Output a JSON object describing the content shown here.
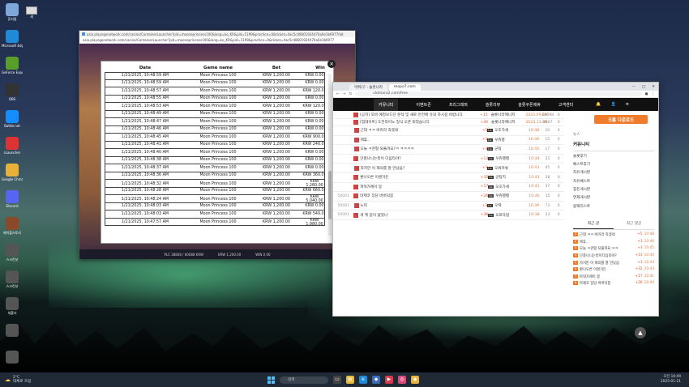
{
  "desktop": {
    "icons": [
      {
        "label": "휴지통",
        "icon": "recycle-bin-icon",
        "color": "#7fa7d9"
      },
      {
        "label": "Microsoft Edge",
        "icon": "edge-icon",
        "color": "#1f8ad8"
      },
      {
        "label": "GeForce Experience",
        "icon": "geforce-icon",
        "color": "#5a9e2a"
      },
      {
        "label": "OBS",
        "icon": "obs-icon",
        "color": "#333"
      },
      {
        "label": "Battle.net",
        "icon": "battlenet-icon",
        "color": "#148eff"
      },
      {
        "label": "sLauncher",
        "icon": "slauncher-icon",
        "color": "#d33"
      },
      {
        "label": "Google Chrome",
        "icon": "chrome-icon",
        "color": "#e8b23a"
      },
      {
        "label": "Discord",
        "icon": "discord-icon",
        "color": "#5865f2"
      },
      {
        "label": "메이플스토리",
        "icon": "game-icon",
        "color": "#8a4a2a"
      },
      {
        "label": "스크린샷",
        "icon": "folder-icon",
        "color": "#555"
      },
      {
        "label": "스크린샷",
        "icon": "folder-icon",
        "color": "#555"
      },
      {
        "label": "새폴더",
        "icon": "folder-icon",
        "color": "#555"
      },
      {
        "label": "",
        "icon": "file-icon",
        "color": "#555"
      },
      {
        "label": "",
        "icon": "file-icon",
        "color": "#555"
      }
    ],
    "second_icon_label": "새"
  },
  "popup": {
    "title": "asia.playngonetwork.com/casino/ContainerLauncher?pid=mooneprincess100&lang=ko_KR&pid=1199&practice=0&ticket=4ac5c48601924470a0e1b6977fa8",
    "url": "asia.playngonetwork.com/casino/ContainerLauncher?pid=mooneprincess100&lang=ko_KR&pid=1199&practice=0&ticket=4ac5c48601924470a0e1b6977",
    "game_footer": [
      "PLC 38808 / 60088 KRW",
      "KRW 1,200.00",
      "WIN 0.00"
    ],
    "history": {
      "headers": {
        "date": "Date",
        "game": "Game name",
        "bet": "Bet",
        "win": "Win"
      },
      "rows": [
        {
          "date": "1/21/2025, 10:48:59 AM",
          "game": "Moon Princess 100",
          "bet": "KRW 1,200.00",
          "win": "KRW 0.00"
        },
        {
          "date": "1/21/2025, 10:48:59 AM",
          "game": "Moon Princess 100",
          "bet": "KRW 1,200.00",
          "win": "KRW 0.00"
        },
        {
          "date": "1/21/2025, 10:48:57 AM",
          "game": "Moon Princess 100",
          "bet": "KRW 1,200.00",
          "win": "KRW 120.00"
        },
        {
          "date": "1/21/2025, 10:48:55 AM",
          "game": "Moon Princess 100",
          "bet": "KRW 1,200.00",
          "win": "KRW 0.00"
        },
        {
          "date": "1/21/2025, 10:48:53 AM",
          "game": "Moon Princess 100",
          "bet": "KRW 1,200.00",
          "win": "KRW 120.00"
        },
        {
          "date": "1/21/2025, 10:48:49 AM",
          "game": "Moon Princess 100",
          "bet": "KRW 1,200.00",
          "win": "KRW 0.00"
        },
        {
          "date": "1/21/2025, 10:48:47 AM",
          "game": "Moon Princess 100",
          "bet": "KRW 1,200.00",
          "win": "KRW 0.00"
        },
        {
          "date": "1/21/2025, 10:48:46 AM",
          "game": "Moon Princess 100",
          "bet": "KRW 1,200.00",
          "win": "KRW 0.00"
        },
        {
          "date": "1/21/2025, 10:48:45 AM",
          "game": "Moon Princess 100",
          "bet": "KRW 1,200.00",
          "win": "KRW 900.00"
        },
        {
          "date": "1/21/2025, 10:48:41 AM",
          "game": "Moon Princess 100",
          "bet": "KRW 1,200.00",
          "win": "KRW 240.00"
        },
        {
          "date": "1/21/2025, 10:48:40 AM",
          "game": "Moon Princess 100",
          "bet": "KRW 1,200.00",
          "win": "KRW 0.00"
        },
        {
          "date": "1/21/2025, 10:48:38 AM",
          "game": "Moon Princess 100",
          "bet": "KRW 1,200.00",
          "win": "KRW 0.00"
        },
        {
          "date": "1/21/2025, 10:48:37 AM",
          "game": "Moon Princess 100",
          "bet": "KRW 1,200.00",
          "win": "KRW 0.00"
        },
        {
          "date": "1/21/2025, 10:48:36 AM",
          "game": "Moon Princess 100",
          "bet": "KRW 1,200.00",
          "win": "KRW 360.00"
        },
        {
          "date": "1/21/2025, 10:48:32 AM",
          "game": "Moon Princess 100",
          "bet": "KRW 1,200.00",
          "win": "KRW 1,260.00"
        },
        {
          "date": "1/21/2025, 10:48:28 AM",
          "game": "Moon Princess 100",
          "bet": "KRW 1,200.00",
          "win": "KRW 660.00"
        },
        {
          "date": "1/21/2025, 10:48:24 AM",
          "game": "Moon Princess 100",
          "bet": "KRW 1,200.00",
          "win": "KRW 5,040.00"
        },
        {
          "date": "1/21/2025, 10:48:03 AM",
          "game": "Moon Princess 100",
          "bet": "KRW 1,200.00",
          "win": "KRW 0.00"
        },
        {
          "date": "1/21/2025, 10:48:03 AM",
          "game": "Moon Princess 100",
          "bet": "KRW 1,200.00",
          "win": "KRW 540.00"
        },
        {
          "date": "1/21/2025, 10:47:57 AM",
          "game": "Moon Princess 100",
          "bet": "KRW 1,200.00",
          "win": "KRW 1,980.00"
        }
      ]
    }
  },
  "browser": {
    "tabs": [
      "먹튀/구 - 슬롯나라",
      "mopo7.com"
    ],
    "url": "slotnara2.com/free",
    "nav": [
      "커뮤니티",
      "이벤트존",
      "프리그래퍼",
      "슬롯리뷰",
      "슬롯쿠폰제휴",
      "고객센터"
    ],
    "nav_active": "커뮤니티",
    "posts": [
      {
        "no": "",
        "title": "[공지] 모바 예정보드단 분석 및 새로 안전에 유의 하시길 바랍니다.",
        "count": "+15",
        "author": "슬롯나라매니저",
        "lv": "",
        "date": "2023.09.08",
        "views": "22698",
        "likes": "0"
      },
      {
        "no": "",
        "title": "[업데이트] 도전라이노 정식 오픈 되었습니다",
        "count": "+39",
        "author": "슬롯나라매니저",
        "lv": "",
        "date": "2024.11.05",
        "views": "8907",
        "likes": "0"
      },
      {
        "no": "",
        "title": "근데 ㅋㅋ 바카라 죽겠네",
        "count": "+5",
        "author": "오호가세",
        "lv": "Lv.",
        "date": "10:48",
        "views": "10",
        "likes": "0"
      },
      {
        "no": "",
        "title": "에휴..",
        "count": "+3",
        "author": "우쥬쭝",
        "lv": "Lv.",
        "date": "10:46",
        "views": "15",
        "likes": "0"
      },
      {
        "no": "",
        "title": "오늘 ㅋ관형 되줄까요?ㅋ ㅋㅋㅋㅋ",
        "count": "+3",
        "author": "군팅",
        "lv": "Lv.",
        "date": "10:45",
        "views": "17",
        "likes": "0"
      },
      {
        "no": "",
        "title": "단풍나니는킹이 다음타야?",
        "count": "+13",
        "author": "우쥬팽팽",
        "lv": "Lv.",
        "date": "10:44",
        "views": "21",
        "likes": "0"
      },
      {
        "no": "",
        "title": "자지만 이 재의를 잘 만났음?",
        "count": "+3",
        "author": "오류카류",
        "lv": "Lv.",
        "date": "10:43",
        "views": "45",
        "likes": "0"
      },
      {
        "no": "",
        "title": "환나오른 이렌거든",
        "count": "+32",
        "author": "군팅지",
        "lv": "Lv.",
        "date": "10:43",
        "views": "28",
        "likes": "0"
      },
      {
        "no": "",
        "title": "파워가례이 봉",
        "count": "+17",
        "author": "오호가세",
        "lv": "Lv.",
        "date": "10:41",
        "views": "37",
        "likes": "0"
      },
      {
        "no": "50001",
        "title": "마제코 장담 버버덕봉",
        "count": "+26",
        "author": "우쥬팽팽",
        "lv": "Lv.",
        "date": "10:40",
        "views": "15",
        "likes": "0"
      },
      {
        "no": "50001",
        "title": "노피",
        "count": "+3",
        "author": "오택",
        "lv": "Lv.",
        "date": "10:39",
        "views": "73",
        "likes": "0"
      },
      {
        "no": "50001",
        "title": "게 케 봉이 없었나",
        "count": "+36",
        "author": "오로다쌈",
        "lv": "Lv.",
        "date": "10:38",
        "views": "23",
        "likes": "0"
      }
    ],
    "side": {
      "download_button": "크롬 다운로드",
      "menu_small": "뉴스",
      "header": "커뮤니티",
      "items": [
        "슬롯후기",
        "베스트후기",
        "자유게시판",
        "자유베스트",
        "힘든게시판",
        "연재게시판",
        "블랙리스트"
      ],
      "tabs": [
        "최근 글",
        "최근 댓글"
      ],
      "recent": [
        {
          "n": "1",
          "t": "근데 ㅋㅋ 바카라 죽겠네",
          "c": "+5",
          "d": "10:48"
        },
        {
          "n": "2",
          "t": "에휴..",
          "c": "+3",
          "d": "10:46"
        },
        {
          "n": "3",
          "t": "오늘 ㅋ관형 되줄까요 ㅋㅋ",
          "c": "+3",
          "d": "10:45"
        },
        {
          "n": "4",
          "t": "단풍나니는킹이다음타야?",
          "c": "+13",
          "d": "10:44"
        },
        {
          "n": "5",
          "t": "자지만 이 재의를 잘 만났음",
          "c": "+3",
          "d": "10:43"
        },
        {
          "n": "6",
          "t": "환나오른 이렌거든",
          "c": "+32",
          "d": "10:43"
        },
        {
          "n": "7",
          "t": "파워가례이 봉",
          "c": "+17",
          "d": "10:41"
        },
        {
          "n": "8",
          "t": "마제코 장담 버버덕봉",
          "c": "+26",
          "d": "10:40"
        }
      ]
    }
  },
  "taskbar": {
    "weather_temp": "2°C",
    "weather_desc": "대체로 흐림",
    "search_placeholder": "검색",
    "time": "오전 10:49",
    "date": "2025-01-21"
  }
}
